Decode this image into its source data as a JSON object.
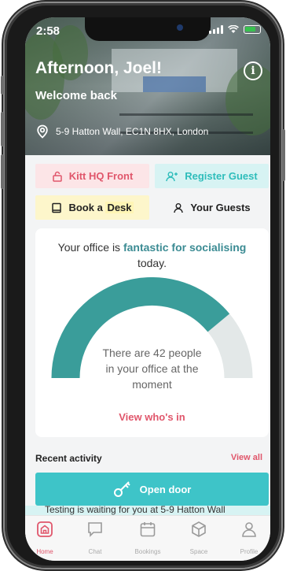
{
  "status_bar": {
    "time": "2:58"
  },
  "header": {
    "greeting": "Afternoon, Joel!",
    "subtitle": "Welcome back",
    "info_icon": "info-icon",
    "address": "5-9 Hatton Wall, EC1N 8HX, London"
  },
  "actions": {
    "kitt": "Kitt HQ Front",
    "register_guest": "Register Guest",
    "book_desk_prefix": "Book a",
    "book_desk_word": "Desk",
    "your_guests": "Your Guests"
  },
  "office_card": {
    "line_prefix": "Your office is ",
    "line_emphasis": "fantastic for socialising",
    "line_suffix": "today.",
    "gauge_fraction": 0.78,
    "occupancy_text_1": "There are 42 people",
    "occupancy_text_2": "in your office at the",
    "occupancy_text_3": "moment",
    "view_link": "View who's in"
  },
  "recent": {
    "title": "Recent activity",
    "view_all": "View all",
    "open_door": "Open door",
    "notification": "Testing  is waiting for you at 5-9 Hatton Wall"
  },
  "tabs": [
    {
      "label": "Home",
      "icon": "home-icon",
      "active": true
    },
    {
      "label": "Chat",
      "icon": "chat-icon",
      "active": false
    },
    {
      "label": "Bookings",
      "icon": "calendar-icon",
      "active": false
    },
    {
      "label": "Space",
      "icon": "cube-icon",
      "active": false
    },
    {
      "label": "Profile",
      "icon": "profile-icon",
      "active": false
    }
  ],
  "colors": {
    "brand_teal": "#3b8b93",
    "accent_pink": "#e0566b",
    "door_teal": "#3ec4c8",
    "gauge_fill": "#3a9d9a",
    "gauge_track": "#e3e8e8"
  }
}
